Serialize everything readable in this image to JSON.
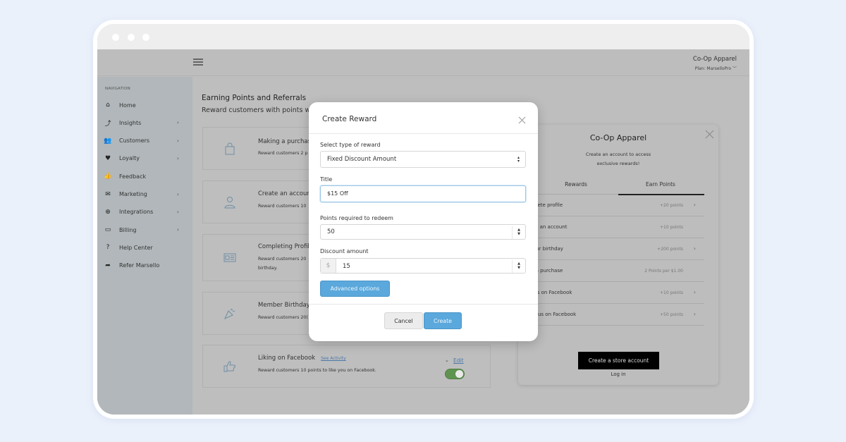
{
  "window": {
    "controls": [
      "close",
      "minimize",
      "maximize"
    ]
  },
  "topbar": {
    "menu_icon": "hamburger-icon",
    "store_name": "Co-Op Apparel",
    "plan": "Plan: MarselloPro",
    "plan_chevron": "﹀"
  },
  "sidebar": {
    "title": "NAVIGATION",
    "items": [
      {
        "label": "Home",
        "icon": "home-icon",
        "glyph": "⌂",
        "has_submenu": false
      },
      {
        "label": "Insights",
        "icon": "trend-icon",
        "glyph": "⤴",
        "has_submenu": true
      },
      {
        "label": "Customers",
        "icon": "users-icon",
        "glyph": "👥",
        "has_submenu": true
      },
      {
        "label": "Loyalty",
        "icon": "heart-icon",
        "glyph": "♥",
        "has_submenu": true
      },
      {
        "label": "Feedback",
        "icon": "thumbs-up-icon",
        "glyph": "👍",
        "has_submenu": false
      },
      {
        "label": "Marketing",
        "icon": "envelope-icon",
        "glyph": "✉",
        "has_submenu": true
      },
      {
        "label": "Integrations",
        "icon": "plus-circle-icon",
        "glyph": "⊕",
        "has_submenu": true
      },
      {
        "label": "Billing",
        "icon": "credit-card-icon",
        "glyph": "▭",
        "has_submenu": true
      },
      {
        "label": "Help Center",
        "icon": "question-circle-icon",
        "glyph": "?",
        "has_submenu": false
      },
      {
        "label": "Refer Marsello",
        "icon": "share-arrow-icon",
        "glyph": "➦",
        "has_submenu": false
      }
    ],
    "chevron": "›"
  },
  "main": {
    "title": "Earning Points and Referrals",
    "subtitle": "Reward customers with points wh",
    "cards": [
      {
        "title": "Making a purchas",
        "desc": [
          "Reward customers 2 p"
        ],
        "icon": "shopping-bag-icon"
      },
      {
        "title": "Create an account",
        "desc": [
          "Reward customers 10"
        ],
        "icon": "user-icon"
      },
      {
        "title": "Completing Profil",
        "desc": [
          "Reward customers 20",
          "birthday."
        ],
        "icon": "id-card-icon"
      },
      {
        "title": "Member Birthday",
        "desc": [
          "Reward customers 20("
        ],
        "icon": "party-popper-icon"
      },
      {
        "title": "Liking on Facebook",
        "desc": [
          "Reward customers 10 points to like you on Facebook."
        ],
        "icon": "thumbs-up-icon",
        "link": "See Activity",
        "edit": "Edit",
        "enabled": true
      }
    ]
  },
  "widget": {
    "title": "Co-Op Apparel",
    "subtitle_line1": "Create an account to access",
    "subtitle_line2": "exclusive rewards!",
    "tabs": [
      {
        "label": "Rewards",
        "active": false
      },
      {
        "label": "Earn Points",
        "active": true
      }
    ],
    "rows": [
      {
        "label": "omplete profile",
        "points": "+20 points",
        "chevron": true
      },
      {
        "label": "reate an account",
        "points": "+10 points",
        "chevron": false
      },
      {
        "label": "n your birthday",
        "points": "+200 points",
        "chevron": true
      },
      {
        "label": "ake a purchase",
        "points": "2 Points per $1.00",
        "chevron": false
      },
      {
        "label": "ike us on Facebook",
        "points": "+10 points",
        "chevron": true
      },
      {
        "label": "hare us on Facebook",
        "points": "+50 points",
        "chevron": true
      }
    ],
    "cta": "Create a store account",
    "login": "Log in"
  },
  "modal": {
    "title": "Create Reward",
    "reward_type_label": "Select type of reward",
    "reward_type_value": "Fixed Discount Amount",
    "title_label": "Title",
    "title_value": "$15 Off",
    "points_label": "Points required to redeem",
    "points_value": "50",
    "discount_label": "Discount amount",
    "discount_prefix": "$",
    "discount_value": "15",
    "advanced_button": "Advanced options",
    "cancel_button": "Cancel",
    "create_button": "Create"
  },
  "colors": {
    "primary_button": "#5aa8dc",
    "toggle_on": "#5e9450",
    "link": "#4a78a8",
    "page_bg": "#ebf1fb"
  }
}
